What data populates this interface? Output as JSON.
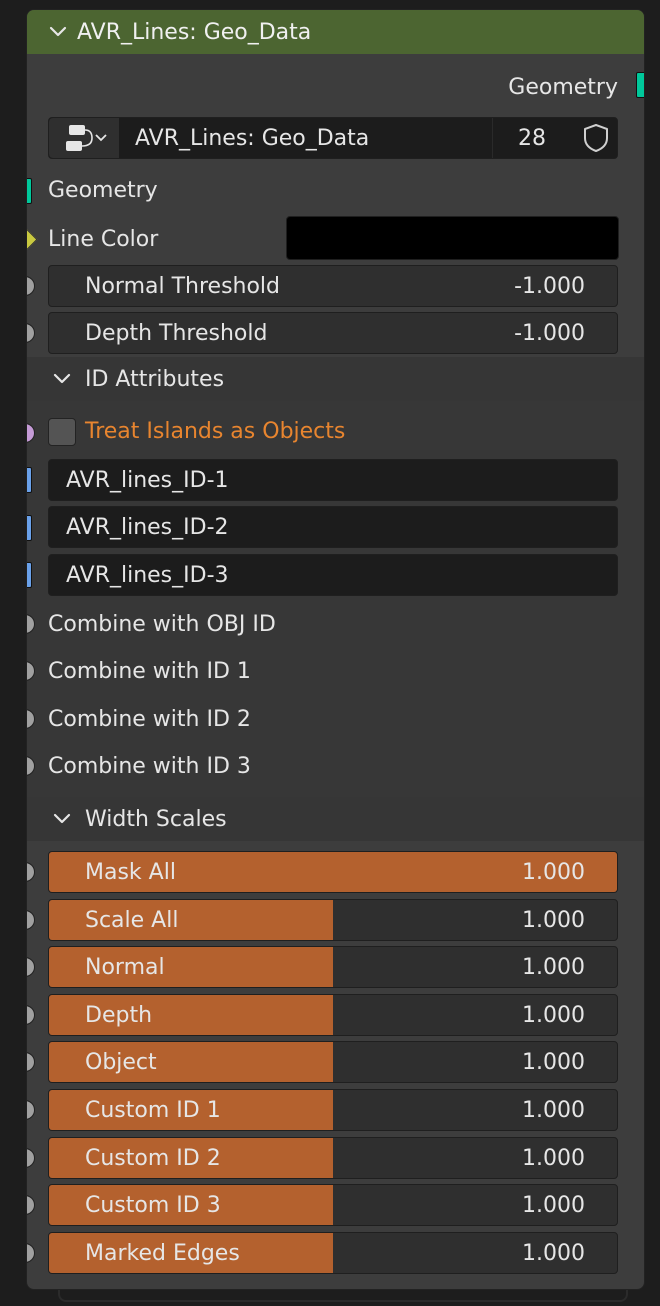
{
  "header": {
    "title": "AVR_Lines: Geo_Data"
  },
  "output": {
    "label": "Geometry"
  },
  "group_selector": {
    "name": "AVR_Lines: Geo_Data",
    "users": "28"
  },
  "inputs": {
    "geometry": "Geometry",
    "line_color": {
      "label": "Line Color",
      "value": "#000000"
    },
    "normal_threshold": {
      "label": "Normal Threshold",
      "value": "-1.000"
    },
    "depth_threshold": {
      "label": "Depth Threshold",
      "value": "-1.000"
    }
  },
  "id_attributes": {
    "title": "ID Attributes",
    "treat_islands": "Treat Islands as Objects",
    "ids": [
      "AVR_lines_ID-1",
      "AVR_lines_ID-2",
      "AVR_lines_ID-3"
    ],
    "combine": [
      "Combine with OBJ ID",
      "Combine with ID 1",
      "Combine with ID 2",
      "Combine with ID 3"
    ]
  },
  "width_scales": {
    "title": "Width Scales",
    "items": [
      {
        "label": "Mask All",
        "value": "1.000",
        "fill": 1.0
      },
      {
        "label": "Scale All",
        "value": "1.000",
        "fill": 0.5
      },
      {
        "label": "Normal",
        "value": "1.000",
        "fill": 0.5
      },
      {
        "label": "Depth",
        "value": "1.000",
        "fill": 0.5
      },
      {
        "label": "Object",
        "value": "1.000",
        "fill": 0.5
      },
      {
        "label": "Custom ID 1",
        "value": "1.000",
        "fill": 0.5
      },
      {
        "label": "Custom ID 2",
        "value": "1.000",
        "fill": 0.5
      },
      {
        "label": "Custom ID 3",
        "value": "1.000",
        "fill": 0.5
      },
      {
        "label": "Marked Edges",
        "value": "1.000",
        "fill": 0.5
      }
    ]
  },
  "colors": {
    "header": "#4c6531",
    "accent": "#b4612e",
    "bool_label": "#e8852f",
    "geometry_socket": "#00c89b",
    "string_socket": "#6aa1ea"
  }
}
